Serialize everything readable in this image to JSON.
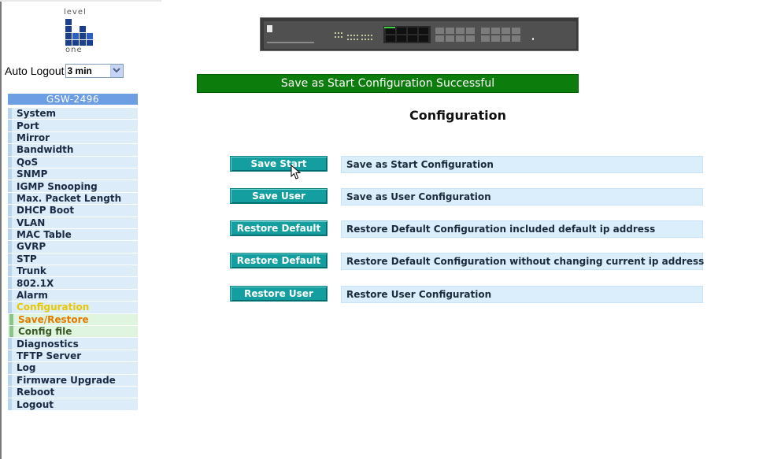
{
  "sidebar": {
    "logo": {
      "word_top": "level",
      "word_bottom": "one"
    },
    "auto_logout": {
      "label": "Auto Logout",
      "value": "3 min"
    },
    "device_title": "GSW-2496",
    "items": [
      {
        "label": "System"
      },
      {
        "label": "Port"
      },
      {
        "label": "Mirror"
      },
      {
        "label": "Bandwidth"
      },
      {
        "label": "QoS"
      },
      {
        "label": "SNMP"
      },
      {
        "label": "IGMP Snooping"
      },
      {
        "label": "Max. Packet Length"
      },
      {
        "label": "DHCP Boot"
      },
      {
        "label": "VLAN"
      },
      {
        "label": "MAC Table"
      },
      {
        "label": "GVRP"
      },
      {
        "label": "STP"
      },
      {
        "label": "Trunk"
      },
      {
        "label": "802.1X"
      },
      {
        "label": "Alarm"
      },
      {
        "label": "Configuration"
      },
      {
        "label": "Save/Restore"
      },
      {
        "label": "Config file"
      },
      {
        "label": "Diagnostics"
      },
      {
        "label": "TFTP Server"
      },
      {
        "label": "Log"
      },
      {
        "label": "Firmware Upgrade"
      },
      {
        "label": "Reboot"
      },
      {
        "label": "Logout"
      }
    ]
  },
  "main": {
    "status_message": "Save as Start Configuration Successful",
    "title": "Configuration",
    "actions": [
      {
        "button": "Save Start",
        "description": "Save as Start Configuration"
      },
      {
        "button": "Save User",
        "description": "Save as User Configuration"
      },
      {
        "button": "Restore Default",
        "description": "Restore Default Configuration included default ip address"
      },
      {
        "button": "Restore Default",
        "description": "Restore Default Configuration without changing current ip address"
      },
      {
        "button": "Restore User",
        "description": "Restore User Configuration"
      }
    ]
  },
  "colors": {
    "success_bar": "#0c7d0c",
    "button": "#149ea0",
    "menu_background": "#dcecf8",
    "device_title_bar": "#6d9ee4",
    "active_menu_text": "#e8c800",
    "current_submenu_text": "#e07a00"
  },
  "icons": {
    "logo": "levelone-logo-icon",
    "banner": "switch-device-image",
    "dropdown": "chevron-down-icon",
    "cursor": "mouse-pointer-icon"
  }
}
